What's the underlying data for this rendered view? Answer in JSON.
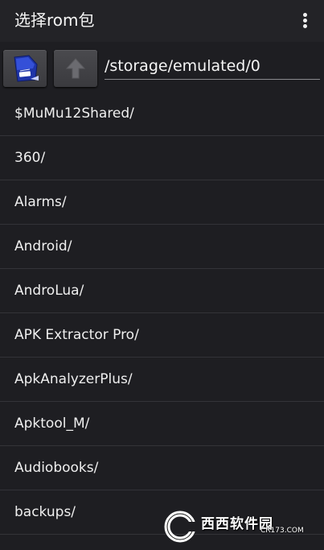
{
  "app": {
    "title": "选择rom包",
    "menu_icon": "more-vert-icon"
  },
  "toolbar": {
    "sd_icon": "sd-card-icon",
    "up_icon": "arrow-up-icon",
    "current_path": "/storage/emulated/0"
  },
  "files": [
    {
      "name": "$MuMu12Shared/"
    },
    {
      "name": "360/"
    },
    {
      "name": "Alarms/"
    },
    {
      "name": "Android/"
    },
    {
      "name": "AndroLua/"
    },
    {
      "name": "APK Extractor Pro/"
    },
    {
      "name": "ApkAnalyzerPlus/"
    },
    {
      "name": "Apktool_M/"
    },
    {
      "name": "Audiobooks/"
    },
    {
      "name": "backups/"
    }
  ],
  "watermark": {
    "letters": "Cr",
    "text": "西西软件园",
    "sub": "CR173.COM"
  },
  "colors": {
    "background": "#1e1e22",
    "appbar": "#232327",
    "divider": "#333338",
    "text": "#efefef",
    "sd_card": "#2a3fb0"
  }
}
